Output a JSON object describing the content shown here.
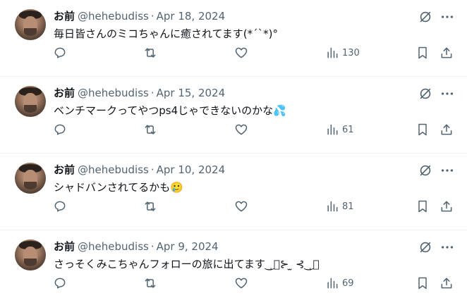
{
  "tweets": [
    {
      "name": "お前",
      "handle": "@hehebudiss",
      "separator": "·",
      "date": "Apr 18, 2024",
      "text": "毎日皆さんのミコちゃんに癒されてます(*´`*)°",
      "emoji": "",
      "views": "130"
    },
    {
      "name": "お前",
      "handle": "@hehebudiss",
      "separator": "·",
      "date": "Apr 15, 2024",
      "text": "ベンチマークってやつps4じゃできないのかな",
      "emoji": "💦",
      "views": "61"
    },
    {
      "name": "お前",
      "handle": "@hehebudiss",
      "separator": "·",
      "date": "Apr 10, 2024",
      "text": "シャドバンされてるかも",
      "emoji": "🥲",
      "views": "81"
    },
    {
      "name": "お前",
      "handle": "@hehebudiss",
      "separator": "·",
      "date": "Apr 9, 2024",
      "text": "さっそくみこちゃんフォローの旅に出てます‿̩͙⊱ ̫ ⊰‿̩͙",
      "emoji": "",
      "views": "69"
    }
  ],
  "icons": {
    "reply": "reply-icon",
    "retweet": "retweet-icon",
    "like": "heart-icon",
    "views": "views-chart-icon",
    "bookmark": "bookmark-icon",
    "share": "share-icon",
    "grok": "grok-icon",
    "more": "more-icon"
  },
  "colors": {
    "text": "#0f1419",
    "secondary": "#536471",
    "divider": "#eff3f4"
  }
}
